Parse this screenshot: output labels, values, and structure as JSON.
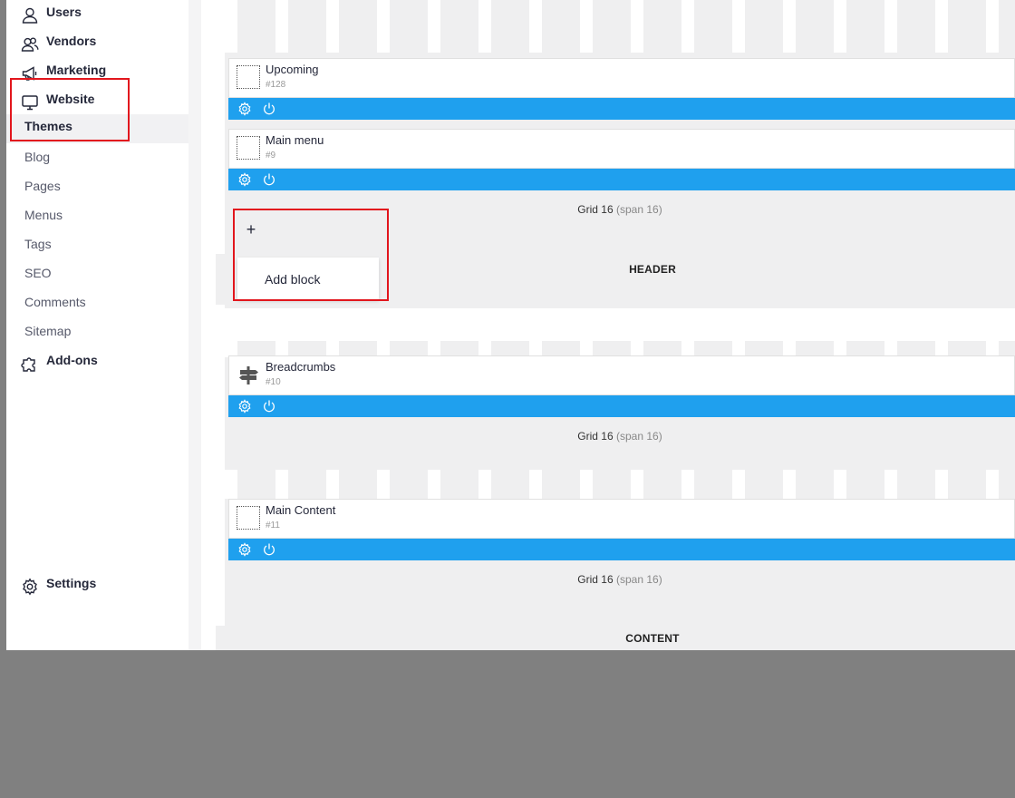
{
  "sidebar": {
    "items": [
      {
        "label": "Users",
        "icon": "user-icon"
      },
      {
        "label": "Vendors",
        "icon": "users-icon"
      },
      {
        "label": "Marketing",
        "icon": "megaphone-icon"
      },
      {
        "label": "Website",
        "icon": "monitor-icon"
      },
      {
        "label": "Add-ons",
        "icon": "puzzle-icon"
      },
      {
        "label": "Settings",
        "icon": "gear-icon"
      }
    ],
    "website_sub": [
      "Themes",
      "Blog",
      "Pages",
      "Menus",
      "Tags",
      "SEO",
      "Comments",
      "Sitemap"
    ],
    "active_sub": "Themes"
  },
  "layout": {
    "blocks": [
      {
        "name": "Upcoming",
        "id": "#128",
        "icon": "placeholder-block-icon"
      },
      {
        "name": "Main menu",
        "id": "#9",
        "icon": "placeholder-block-icon"
      },
      {
        "name": "Breadcrumbs",
        "id": "#10",
        "icon": "signpost-icon"
      },
      {
        "name": "Main Content",
        "id": "#11",
        "icon": "placeholder-block-icon"
      }
    ],
    "grids": [
      {
        "label": "Grid 16",
        "span": "(span 16)"
      },
      {
        "label": "Grid 16",
        "span": "(span 16)"
      },
      {
        "label": "Grid 16",
        "span": "(span 16)"
      }
    ],
    "sections": [
      "HEADER",
      "CONTENT"
    ],
    "add_block": {
      "plus": "+",
      "label": "Add block"
    }
  },
  "colors": {
    "accent_bar": "#1fa0ee",
    "highlight": "#e2161d",
    "canvas": "#efeff0",
    "outside": "#808080"
  }
}
